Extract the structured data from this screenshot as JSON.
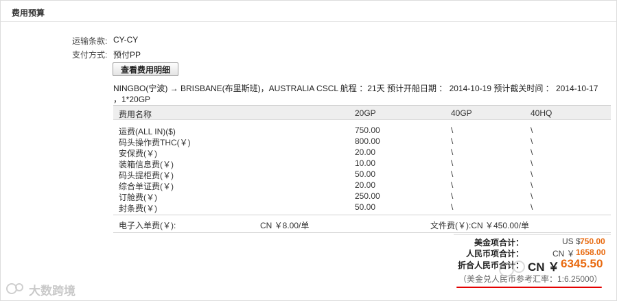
{
  "panel": {
    "title": "费用预算"
  },
  "terms": {
    "transport_label": "运输条款:",
    "transport_value": "CY-CY",
    "payment_label": "支付方式:",
    "payment_value": "预付PP"
  },
  "detail_button": "查看费用明细",
  "route": {
    "text": "NINGBO(宁波) → BRISBANE(布里斯班)，AUSTRALIA   CSCL   航程 ：21天    预计开船日期 ： 2014-10-19    预计截关时间 ： 2014-10-17   ，1*20GP"
  },
  "fee_table": {
    "headers": [
      "费用名称",
      "20GP",
      "40GP",
      "40HQ"
    ],
    "rows": [
      [
        "运费(ALL IN)($)",
        "750.00",
        "\\",
        "\\"
      ],
      [
        "码头操作费THC(￥)",
        "800.00",
        "\\",
        "\\"
      ],
      [
        "安保费(￥)",
        "20.00",
        "\\",
        "\\"
      ],
      [
        "装箱信息费(￥)",
        "10.00",
        "\\",
        "\\"
      ],
      [
        "码头提柜费(￥)",
        "50.00",
        "\\",
        "\\"
      ],
      [
        "综合单证费(￥)",
        "20.00",
        "\\",
        "\\"
      ],
      [
        "订舱费(￥)",
        "250.00",
        "\\",
        "\\"
      ],
      [
        "封条费(￥)",
        "50.00",
        "\\",
        "\\"
      ]
    ]
  },
  "extra_fees": {
    "einput_label": "电子入单费(￥):",
    "einput_value": "CN ￥8.00/单",
    "doc_fee": "文件费(￥):CN ￥450.00/单"
  },
  "totals": {
    "usd_label": "美金项合计：",
    "usd_currency": "US $",
    "usd_value": "750.00",
    "cny_label": "人民币项合计：",
    "cny_currency": "CN ￥",
    "cny_value": "1658.00",
    "combined_label": "折合人民币合计：",
    "combined_currency": "CN ￥",
    "combined_value": "6345.50",
    "rate_note": "（美金兑人民币参考汇率：1:6.25000）"
  },
  "watermark": {
    "text": "大数跨境"
  },
  "colors": {
    "accent": "#e8690e",
    "underline": "#e30000"
  }
}
